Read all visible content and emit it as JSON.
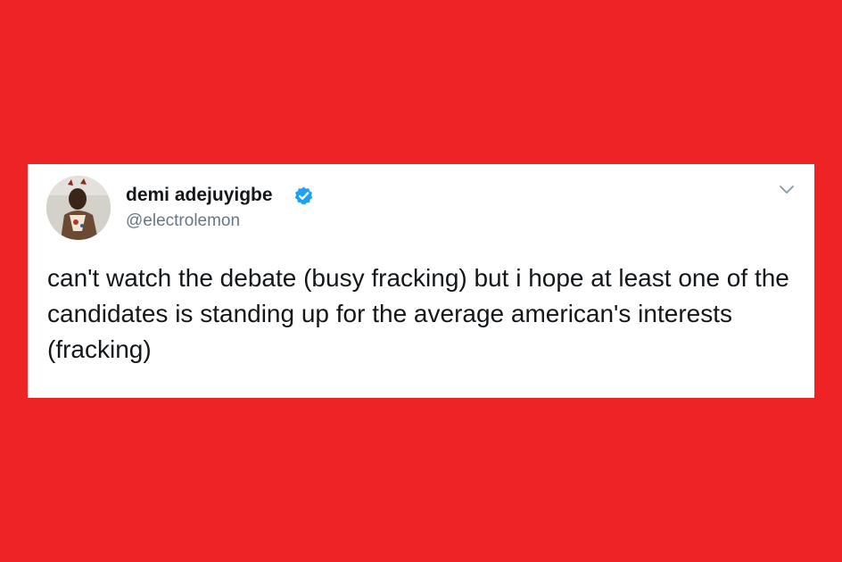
{
  "tweet": {
    "author": {
      "display_name": "demi adejuyigbe",
      "handle": "@electrolemon",
      "verified": true,
      "avatar": "profile-photo"
    },
    "text": "can't watch the debate (busy fracking) but i hope at least one of the candidates is standing up for the average american's interests (fracking)",
    "menu_icon": "chevron-down-icon"
  },
  "colors": {
    "background": "#ee2326",
    "card": "#ffffff",
    "verified_badge": "#1da1f2",
    "handle_text": "#657786",
    "primary_text": "#14171a"
  }
}
